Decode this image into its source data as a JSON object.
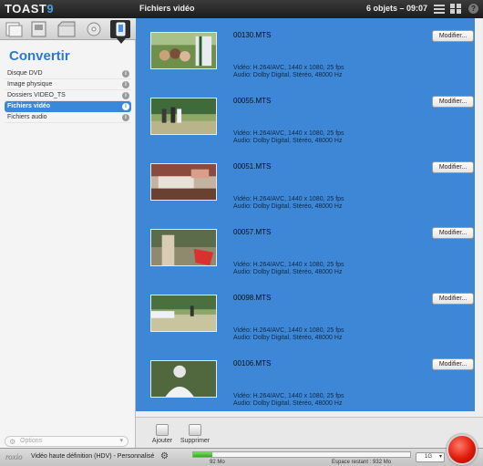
{
  "app": {
    "title": "TOAST",
    "version": "9"
  },
  "window": {
    "title": "Fichiers vidéo",
    "status": "6 objets – 09:07"
  },
  "sidebar": {
    "heading": "Convertir",
    "items": [
      {
        "label": "Disque DVD",
        "selected": false
      },
      {
        "label": "Image physique",
        "selected": false
      },
      {
        "label": "Dossiers VIDEO_TS",
        "selected": false
      },
      {
        "label": "Fichiers vidéo",
        "selected": true
      },
      {
        "label": "Fichiers audio",
        "selected": false
      }
    ],
    "options_label": "Options"
  },
  "files": [
    {
      "name": "00130.MTS",
      "video": "Vidéo: H.264/AVC, 1440 x 1080, 25 fps",
      "audio": "Audio: Dolby Digital, Stéréo, 48000 Hz",
      "button": "Modifier..."
    },
    {
      "name": "00055.MTS",
      "video": "Vidéo: H.264/AVC, 1440 x 1080, 25 fps",
      "audio": "Audio: Dolby Digital, Stéréo, 48000 Hz",
      "button": "Modifier..."
    },
    {
      "name": "00051.MTS",
      "video": "Vidéo: H.264/AVC, 1440 x 1080, 25 fps",
      "audio": "Audio: Dolby Digital, Stéréo, 48000 Hz",
      "button": "Modifier..."
    },
    {
      "name": "00057.MTS",
      "video": "Vidéo: H.264/AVC, 1440 x 1080, 25 fps",
      "audio": "Audio: Dolby Digital, Stéréo, 48000 Hz",
      "button": "Modifier..."
    },
    {
      "name": "00098.MTS",
      "video": "Vidéo: H.264/AVC, 1440 x 1080, 25 fps",
      "audio": "Audio: Dolby Digital, Stéréo, 48000 Hz",
      "button": "Modifier..."
    },
    {
      "name": "00106.MTS",
      "video": "Vidéo: H.264/AVC, 1440 x 1080, 25 fps",
      "audio": "Audio: Dolby Digital, Stéréo, 48000 Hz",
      "button": "Modifier..."
    }
  ],
  "toolbar": {
    "add_label": "Ajouter",
    "delete_label": "Supprimer"
  },
  "statusbar": {
    "brand": "roxio",
    "profile": "Vidéo haute définition (HDV) - Personnalisé",
    "used": "92 Mo",
    "remaining": "Espace restant : 932 Mo",
    "disc_size": "1G",
    "fill_fraction": 0.09
  },
  "colors": {
    "accent": "#3d87d6",
    "record": "#e01a0a",
    "capacity": "#32a91d"
  }
}
